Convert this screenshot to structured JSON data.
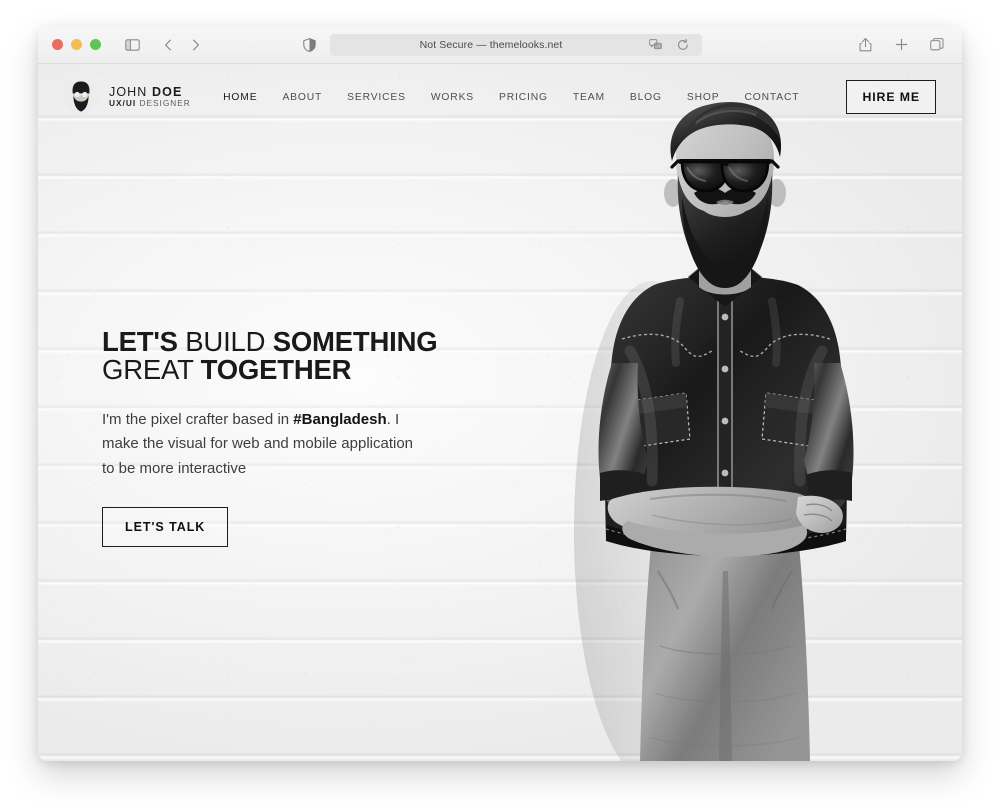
{
  "browser": {
    "address_text": "Not Secure — themelooks.net",
    "traffic_lights": [
      "close",
      "minimize",
      "maximize"
    ],
    "icons": {
      "sidebar_toggle": "sidebar-toggle-icon",
      "back": "back-chevron-icon",
      "forward": "forward-chevron-icon",
      "shield": "privacy-shield-icon",
      "extension": "extension-icon",
      "reload": "reload-icon",
      "share": "share-icon",
      "new_tab": "plus-icon",
      "tab_overview": "tab-overview-icon"
    }
  },
  "site": {
    "brand": {
      "name_light": "JOHN",
      "name_bold": "DOE",
      "role_bold": "UX/UI",
      "role_light": "DESIGNER",
      "avatar_alt": "bearded-man-avatar"
    },
    "nav": [
      {
        "label": "HOME",
        "active": true
      },
      {
        "label": "ABOUT",
        "active": false
      },
      {
        "label": "SERVICES",
        "active": false
      },
      {
        "label": "WORKS",
        "active": false
      },
      {
        "label": "PRICING",
        "active": false
      },
      {
        "label": "TEAM",
        "active": false
      },
      {
        "label": "BLOG",
        "active": false
      },
      {
        "label": "SHOP",
        "active": false
      },
      {
        "label": "CONTACT",
        "active": false
      }
    ],
    "hire_button": "HIRE ME",
    "hero": {
      "title_line1_a": "LET'S ",
      "title_line1_b": "BUILD ",
      "title_line1_c": "SOMETHING",
      "title_line2_a": "GREAT ",
      "title_line2_b": "TOGETHER",
      "sub_a": "I'm the pixel crafter based in ",
      "sub_b": "#Bangladesh",
      "sub_c": ". I make the visual for web and mobile application to be more interactive",
      "cta": "LET'S TALK",
      "photo_alt": "bearded-man-photo"
    }
  },
  "colors": {
    "text_dark": "#1a1a1a",
    "text_muted": "#4f4f4f",
    "border": "#1d1d1d",
    "wall": "#f4f4f4",
    "tl_red": "#ec6a5f",
    "tl_yellow": "#f4bd4f",
    "tl_green": "#61c555"
  }
}
